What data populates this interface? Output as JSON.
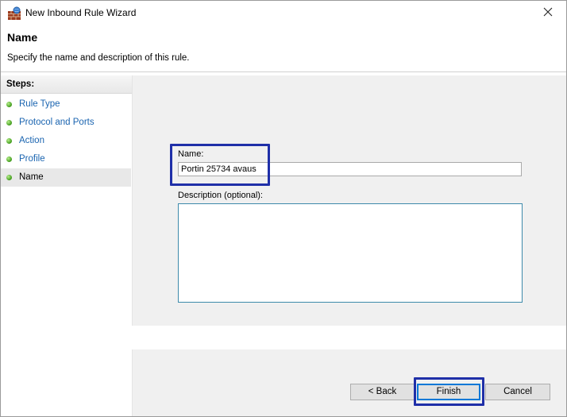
{
  "window": {
    "title": "New Inbound Rule Wizard",
    "icon": "firewall-wall-icon",
    "close_glyph": "✕"
  },
  "header": {
    "title": "Name",
    "subtitle": "Specify the name and description of this rule."
  },
  "steps": {
    "title": "Steps:",
    "items": [
      {
        "label": "Rule Type",
        "state": "completed"
      },
      {
        "label": "Protocol and Ports",
        "state": "completed"
      },
      {
        "label": "Action",
        "state": "completed"
      },
      {
        "label": "Profile",
        "state": "completed"
      },
      {
        "label": "Name",
        "state": "current"
      }
    ]
  },
  "form": {
    "name_label": "Name:",
    "name_value": "Portin 25734 avaus",
    "description_label": "Description (optional):",
    "description_value": ""
  },
  "buttons": {
    "back": "< Back",
    "finish": "Finish",
    "cancel": "Cancel"
  },
  "colors": {
    "highlight": "#1f2fa8",
    "step_link": "#1a64b0",
    "step_dot": "#3f9a1a",
    "content_bg": "#f0f0f0"
  }
}
